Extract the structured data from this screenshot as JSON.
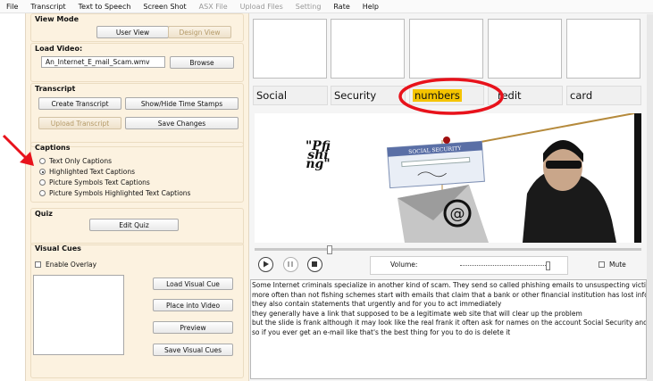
{
  "menu": [
    "File",
    "Transcript",
    "Text to Speech",
    "Screen Shot",
    "ASX File",
    "Upload Files",
    "Setting",
    "Rate",
    "Help"
  ],
  "menu_disabled": [
    false,
    false,
    false,
    false,
    true,
    true,
    true,
    false,
    false
  ],
  "view_mode": {
    "title": "View Mode",
    "user_view": "User View",
    "design_view": "Design View"
  },
  "load_video": {
    "title": "Load Video:",
    "filename": "An_Internet_E_mail_Scam.wmv",
    "browse": "Browse"
  },
  "transcript_group": {
    "title": "Transcript",
    "create": "Create Transcript",
    "show_hide": "Show/Hide Time Stamps",
    "upload": "Upload Transcript",
    "save": "Save Changes"
  },
  "captions": {
    "title": "Captions",
    "options": [
      "Text Only Captions",
      "Highlighted Text Captions",
      "Picture Symbols Text Captions",
      "Picture Symbols Highlighted Text Captions"
    ],
    "selected": 1
  },
  "quiz": {
    "title": "Quiz",
    "edit": "Edit Quiz"
  },
  "visual_cues": {
    "title": "Visual Cues",
    "enable_overlay": "Enable Overlay",
    "load": "Load Visual Cue",
    "place": "Place into Video",
    "preview": "Preview",
    "save": "Save Visual Cues"
  },
  "caption_words": [
    "Social",
    "Security",
    "numbers",
    "redit",
    "card"
  ],
  "highlight_index": 2,
  "video_overlay": {
    "pfishing_text": "\"Pfishing\"",
    "card_title": "SOCIAL SECURITY",
    "envelope_symbol": "@"
  },
  "player": {
    "volume_label": "Volume:",
    "mute_label": "Mute"
  },
  "transcript_lines": [
    "Some Internet criminals specialize in another kind of scam. They send so called phishing emails to unsuspecting victims to steal Social",
    "more often than not fishing schemes start with emails that claim that a bank or other financial institution has lost information or your",
    "they also contain statements that urgently and for you to act immediately",
    "they generally have a link that supposed to be a legitimate web site that will clear up the problem",
    "but the slide is frank although it may look like the real frank it often ask for names on the account Social Security and account numbe",
    "so if you ever get an e-mail like that's the best thing for you to do is delete it"
  ],
  "colors": {
    "panel": "#fcf2e0",
    "highlight": "#f5c400",
    "annotation_red": "#e8121b"
  }
}
